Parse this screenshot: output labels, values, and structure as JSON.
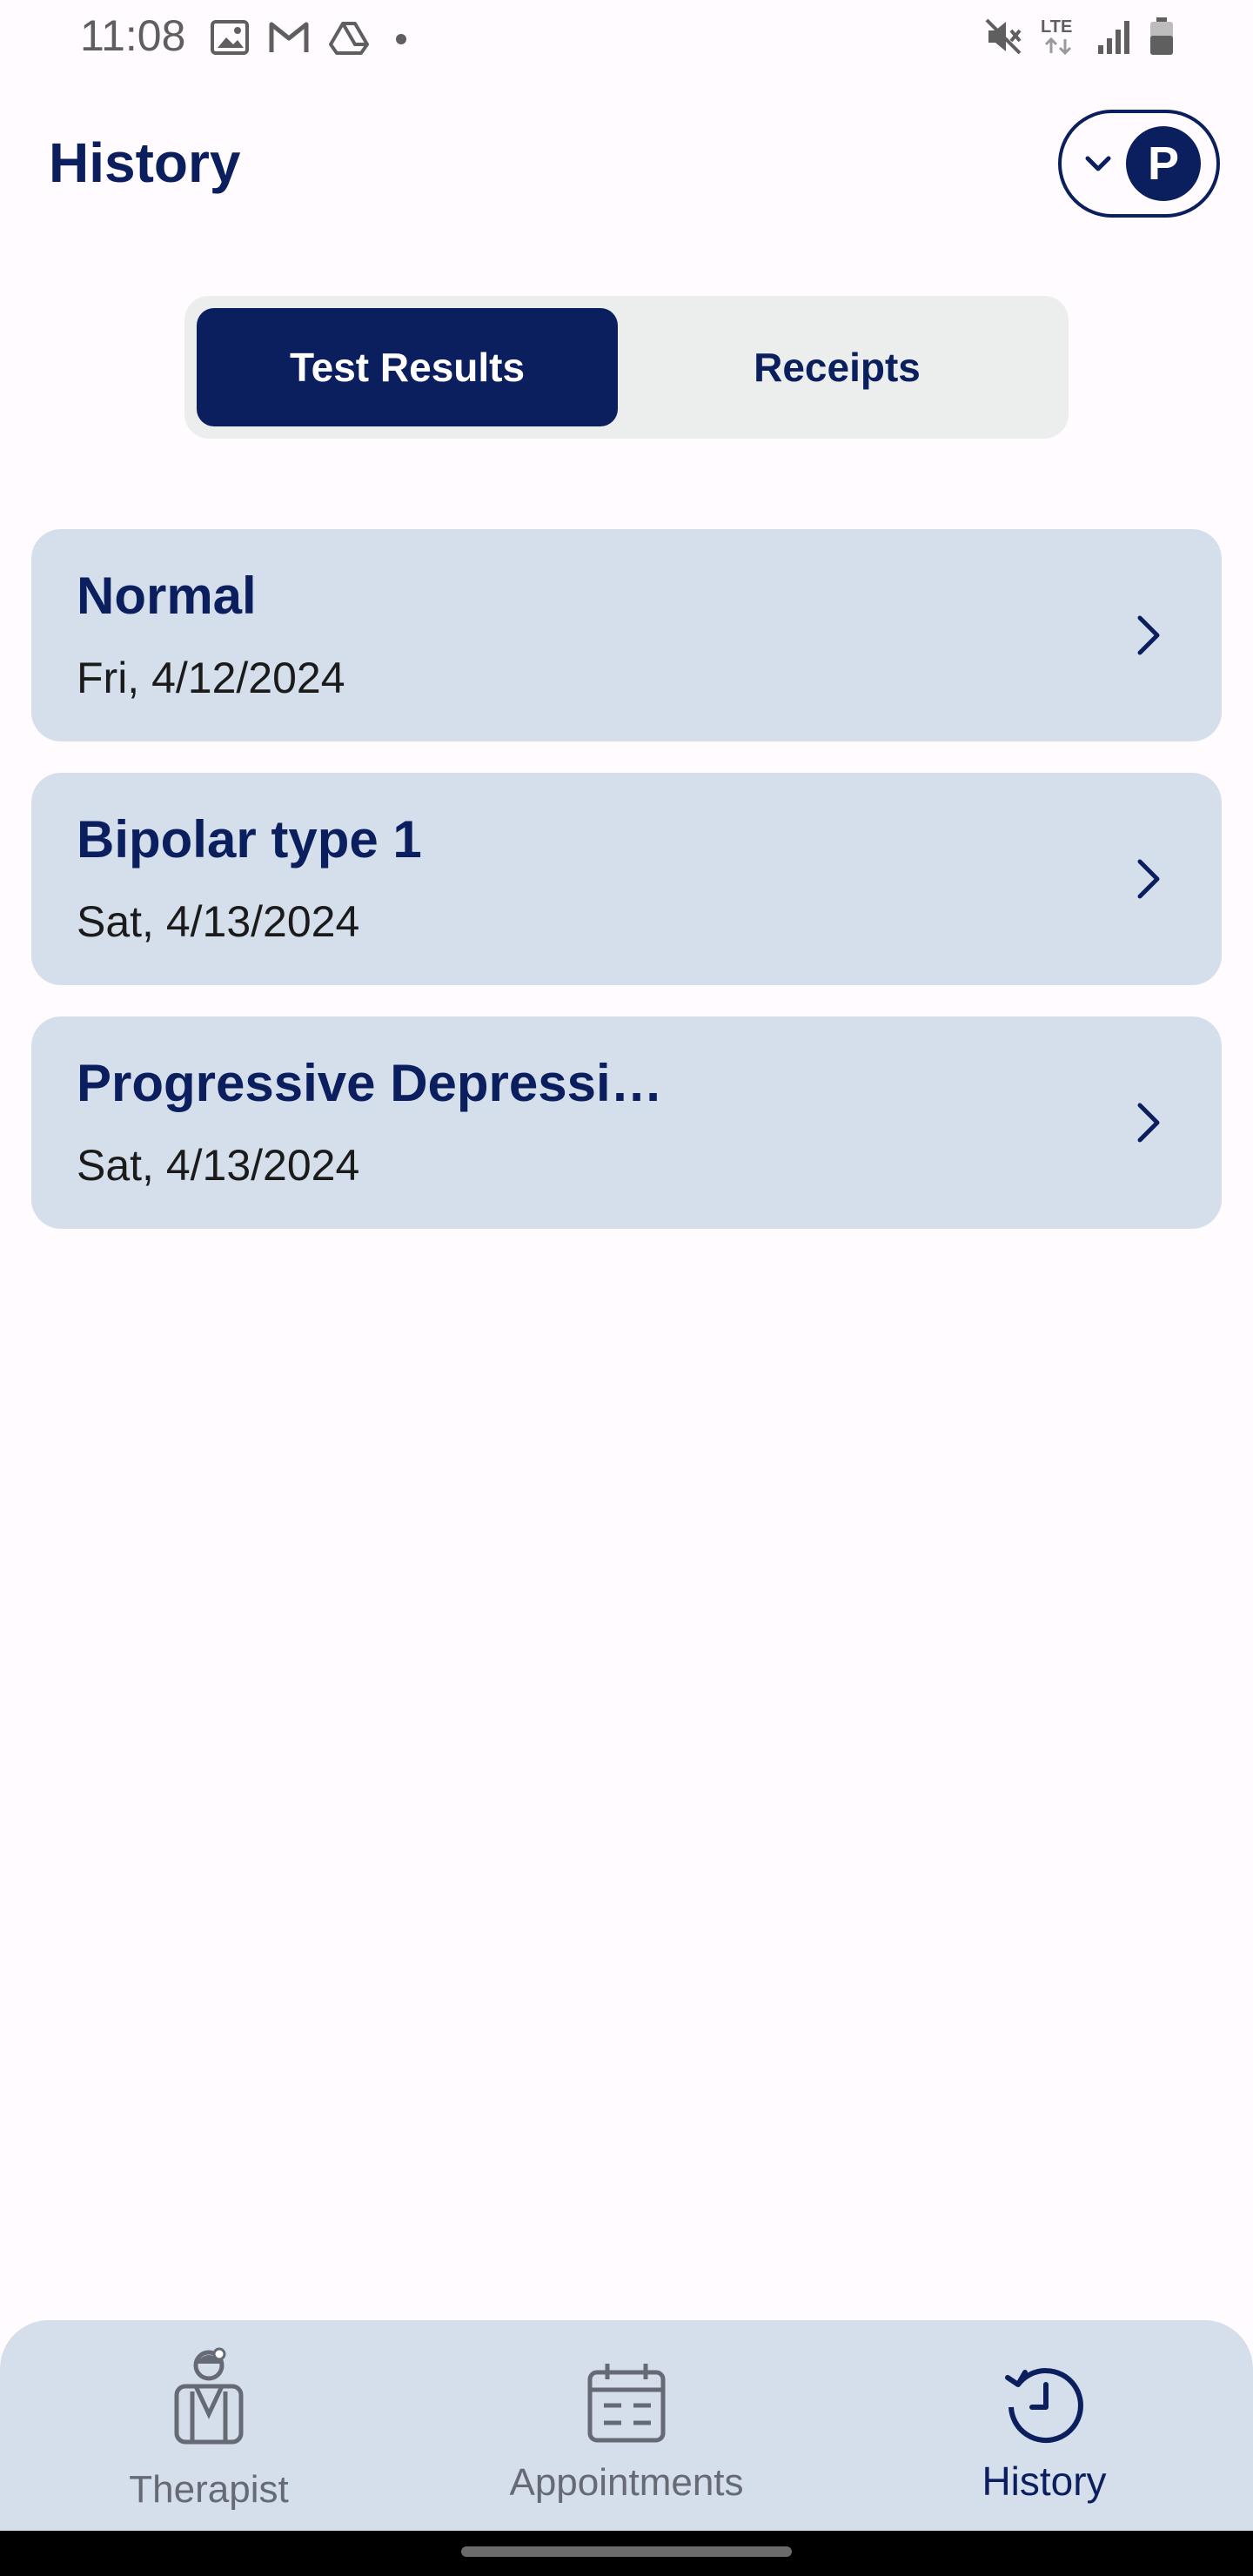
{
  "status_bar": {
    "time": "11:08",
    "left_icons": [
      "image-icon",
      "gmail-icon",
      "drive-icon",
      "dot-icon"
    ],
    "right_icons": [
      "mute-icon",
      "lte-icon",
      "signal-icon",
      "battery-icon"
    ],
    "network_label": "LTE"
  },
  "header": {
    "title": "History",
    "profile_initial": "P"
  },
  "segmented": {
    "tabs": [
      {
        "label": "Test Results",
        "active": true
      },
      {
        "label": "Receipts",
        "active": false
      }
    ]
  },
  "results": [
    {
      "title": "Normal",
      "date": "Fri, 4/12/2024"
    },
    {
      "title": "Bipolar type 1",
      "date": "Sat, 4/13/2024"
    },
    {
      "title": "Progressive Depressi…",
      "date": "Sat, 4/13/2024"
    }
  ],
  "bottom_nav": {
    "items": [
      {
        "label": "Therapist",
        "icon": "therapist-icon",
        "active": false
      },
      {
        "label": "Appointments",
        "icon": "calendar-icon",
        "active": false
      },
      {
        "label": "History",
        "icon": "history-icon",
        "active": true
      }
    ]
  },
  "colors": {
    "primary": "#0b1f5e",
    "card_bg": "#d5dfec",
    "page_bg": "#fffbfe",
    "segment_bg": "#eceeee"
  }
}
